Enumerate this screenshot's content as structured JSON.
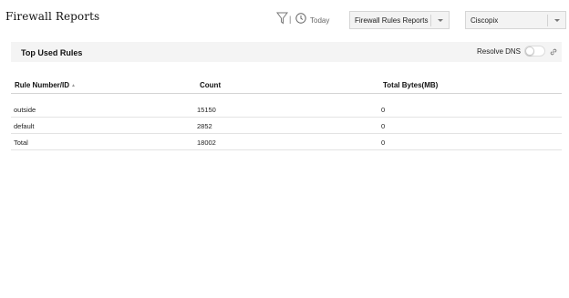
{
  "page": {
    "title": "Firewall Reports"
  },
  "toolbar": {
    "filter_icon": "filter-icon",
    "divider": "|",
    "clock_icon": "clock-icon",
    "time_range": "Today",
    "report_select": {
      "value": "Firewall Rules Reports"
    },
    "device_select": {
      "value": "Ciscopix"
    }
  },
  "panel": {
    "title": "Top Used Rules",
    "resolve_dns_label": "Resolve DNS",
    "resolve_dns_enabled": false,
    "link_icon": "link-icon"
  },
  "table": {
    "columns": [
      "Rule Number/ID",
      "Count",
      "Total Bytes(MB)"
    ],
    "sort": {
      "column": "Rule Number/ID",
      "direction": "ascending"
    },
    "rows": [
      [
        "outside",
        "15150",
        "0"
      ],
      [
        "default",
        "2852",
        "0"
      ],
      [
        "Total",
        "18002",
        "0"
      ]
    ]
  },
  "colors": {
    "panel_bg": "#f4f4f4",
    "select_bg": "#f3f3f3",
    "border": "#d6d6d6",
    "text": "#222222"
  }
}
